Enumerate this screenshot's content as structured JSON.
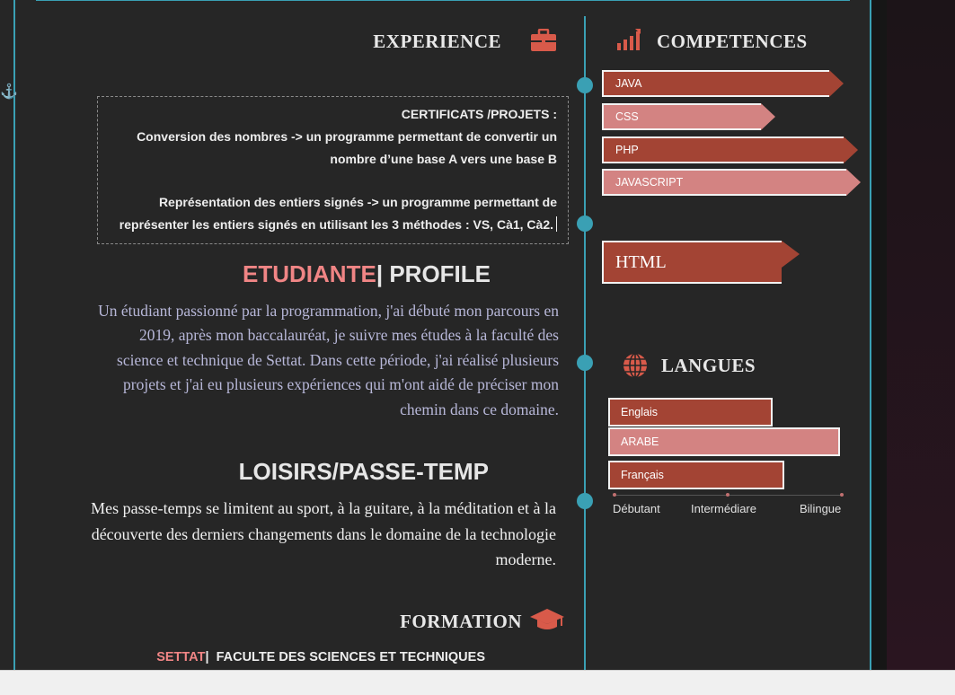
{
  "experience": {
    "title": "EXPERIENCE",
    "icon": "briefcase-icon",
    "certificats_heading": "CERTIFICATS /PROJETS :",
    "projects": [
      "Conversion des nombres -> un programme permettant de convertir un nombre d’une base A vers une base B",
      "Représentation des entiers signés -> un programme permettant de représenter les entiers signés en utilisant les 3 méthodes : VS, Cà1, Cà2."
    ]
  },
  "profile": {
    "title_accent": "ETUDIANTE",
    "title_separator": "|",
    "title_rest": "PROFILE",
    "text": "Un étudiant passionné par la programmation, j'ai débuté mon parcours en 2019, après mon baccalauréat, je suivre mes études à la faculté des science et technique de Settat. Dans cette période, j'ai réalisé plusieurs projets et j'ai eu plusieurs expériences qui m'ont aidé de préciser mon chemin dans ce domaine."
  },
  "loisirs": {
    "title": "LOISIRS/PASSE-TEMP",
    "text": "Mes passe-temps se limitent au sport, à la guitare, à la méditation et à la découverte des derniers changements dans le domaine de la technologie moderne."
  },
  "formation": {
    "title": "FORMATION",
    "icon": "graduation-cap-icon",
    "city": "SETTAT",
    "separator": "|",
    "school": "FACULTE DES SCIENCES ET TECHNIQUES"
  },
  "competences": {
    "title": "COMPETENCES",
    "icon": "bar-chart-icon",
    "skills": [
      {
        "label": "JAVA",
        "level": 0.93,
        "color": "#a34434"
      },
      {
        "label": "CSS",
        "level": 0.65,
        "color": "#d38382"
      },
      {
        "label": "PHP",
        "level": 0.99,
        "color": "#a34434"
      },
      {
        "label": "JAVASCRIPT",
        "level": 1.0,
        "color": "#d38382"
      }
    ],
    "extra_skill": "HTML"
  },
  "langues": {
    "title": "LANGUES",
    "icon": "globe-icon",
    "items": [
      {
        "label": "Englais",
        "level": 0.71,
        "color": "#a34434"
      },
      {
        "label": "ARABE",
        "level": 1.0,
        "color": "#d38382"
      },
      {
        "label": "Français",
        "level": 0.76,
        "color": "#a34434"
      }
    ],
    "scale": [
      "Débutant",
      "Intermédiare",
      "Bilingue"
    ]
  },
  "colors": {
    "accent_teal": "#3aa0b4",
    "accent_red": "#a34434",
    "accent_pink": "#d38382",
    "title_pink": "#f08585"
  },
  "margin_icon": "anchor-icon"
}
